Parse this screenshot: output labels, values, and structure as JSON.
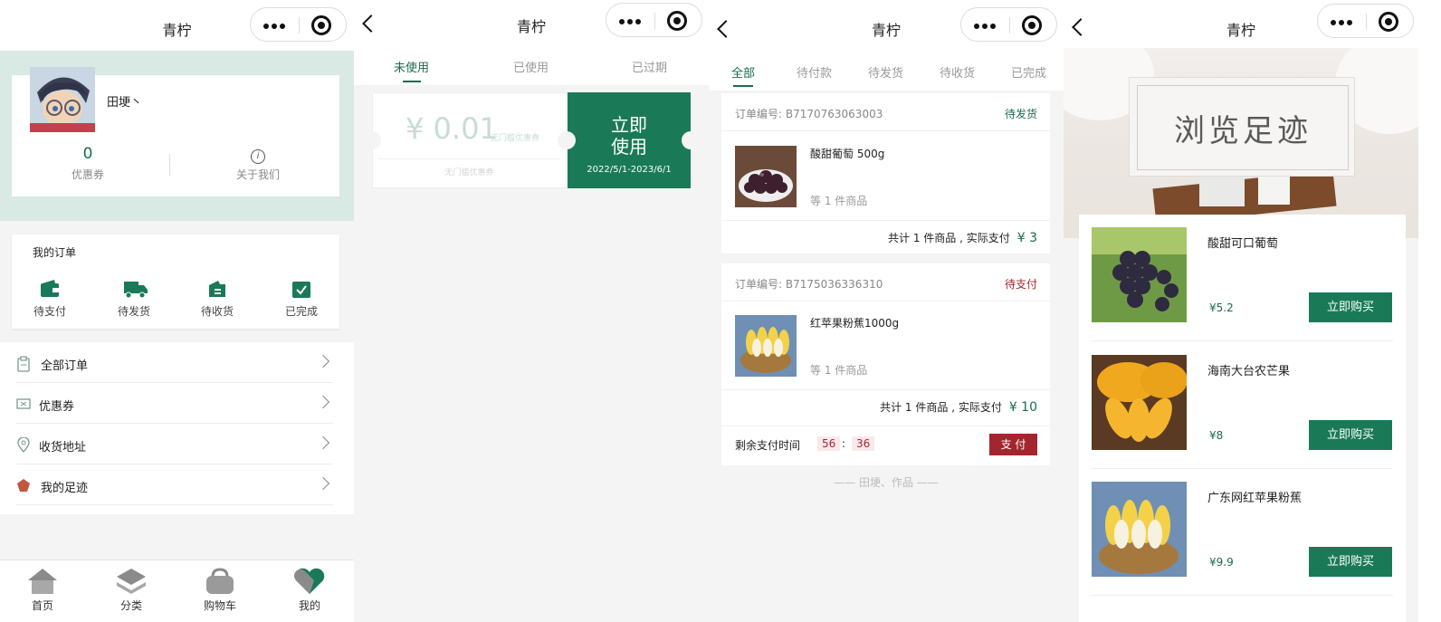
{
  "app": {
    "title": "青柠"
  },
  "screen1": {
    "username": "田埂丶",
    "coupon_count": "0",
    "coupon_label": "优惠券",
    "about_label": "关于我们",
    "orders_title": "我的订单",
    "order_status": [
      {
        "label": "待支付",
        "icon": "wallet-icon"
      },
      {
        "label": "待发货",
        "icon": "truck-icon"
      },
      {
        "label": "待收货",
        "icon": "package-icon"
      },
      {
        "label": "已完成",
        "icon": "check-calendar-icon"
      }
    ],
    "menu": [
      {
        "label": "全部订单",
        "icon": "clipboard-icon"
      },
      {
        "label": "优惠券",
        "icon": "ticket-icon"
      },
      {
        "label": "收货地址",
        "icon": "location-icon"
      },
      {
        "label": "我的足迹",
        "icon": "footprint-icon"
      }
    ],
    "tabbar": [
      {
        "label": "首页",
        "icon": "home-icon"
      },
      {
        "label": "分类",
        "icon": "category-icon"
      },
      {
        "label": "购物车",
        "icon": "cart-icon"
      },
      {
        "label": "我的",
        "icon": "heart-icon",
        "active": true
      }
    ]
  },
  "screen2": {
    "tabs": [
      "未使用",
      "已使用",
      "已过期"
    ],
    "coupon": {
      "amount": "¥ 0.01",
      "tag": "无门槛优惠券",
      "sub": "无门槛优惠券",
      "use_line1": "立即",
      "use_line2": "使用",
      "date": "2022/5/1-2023/6/1"
    }
  },
  "screen3": {
    "tabs": [
      "全部",
      "待付款",
      "待发货",
      "待收货",
      "已完成"
    ],
    "orders": [
      {
        "order_no": "订单编号: B7170763063003",
        "status": "待发货",
        "status_color": "#1a6b4f",
        "product": "酸甜葡萄 500g",
        "count": "等 1 件商品",
        "total_text": "共计 1 件商品 , 实际支付",
        "total_price": "¥ 3"
      },
      {
        "order_no": "订单编号: B7175036336310",
        "status": "待支付",
        "status_color": "#a4252d",
        "product": "红苹果粉蕉1000g",
        "count": "等 1 件商品",
        "total_text": "共计 1 件商品 , 实际支付",
        "total_price": "¥ 10",
        "countdown_label": "剩余支付时间",
        "minutes": "56",
        "colon": ":",
        "seconds": "36",
        "pay_label": "支 付"
      }
    ],
    "footer": "—— 田埂、作品 ——"
  },
  "screen4": {
    "banner_text": "浏览足迹",
    "products": [
      {
        "name": "酸甜可口葡萄",
        "price": "¥5.2",
        "buy": "立即购买"
      },
      {
        "name": "海南大台农芒果",
        "price": "¥8",
        "buy": "立即购买"
      },
      {
        "name": "广东网红苹果粉蕉",
        "price": "¥9.9",
        "buy": "立即购买"
      }
    ]
  },
  "colors": {
    "accent": "#1a7a58",
    "alert": "#a4252d",
    "profile_bg": "#d9e9e3"
  }
}
